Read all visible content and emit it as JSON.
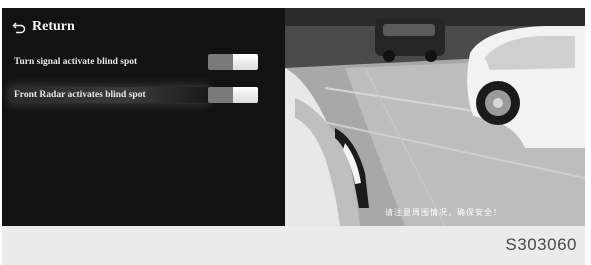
{
  "header": {
    "return_label": "Return",
    "return_icon": "return-arrow-icon"
  },
  "settings": [
    {
      "label": "Turn signal activate blind spot",
      "enabled": true
    },
    {
      "label": "Front Radar activates blind spot",
      "enabled": true
    }
  ],
  "camera": {
    "overlay_text": "请注意周围情况，确保安全！"
  },
  "figure": {
    "code": "S303060"
  },
  "colors": {
    "panel_background": "#121212",
    "label_text": "#e9e9e9",
    "toggle_off": "#7a7a7a",
    "toggle_knob": "#ffffff",
    "footer_background": "#ebebeb"
  }
}
